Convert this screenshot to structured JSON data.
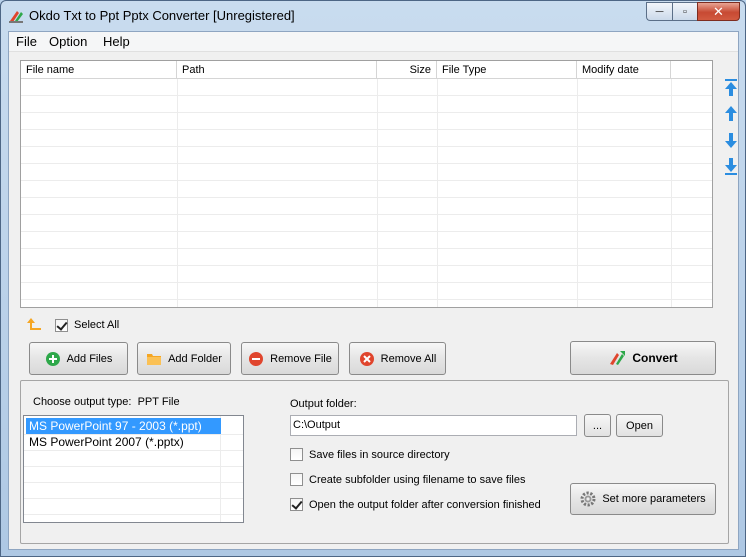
{
  "window": {
    "title": "Okdo Txt to Ppt Pptx Converter [Unregistered]",
    "minimize_glyph": "─",
    "maximize_glyph": "▫",
    "close_glyph": "✕"
  },
  "menu": {
    "items": [
      "File",
      "Option",
      "Help"
    ]
  },
  "file_list": {
    "columns": [
      "File name",
      "Path",
      "Size",
      "File Type",
      "Modify date"
    ],
    "rows": []
  },
  "side_arrows": [
    "move-top-icon",
    "move-up-icon",
    "move-down-icon",
    "move-bottom-icon"
  ],
  "select_all": {
    "label": "Select All",
    "checked": true
  },
  "buttons": {
    "add_files": "Add Files",
    "add_folder": "Add Folder",
    "remove_file": "Remove File",
    "remove_all": "Remove All",
    "convert": "Convert"
  },
  "output": {
    "type_label": "Choose output type:",
    "type_value": "PPT File",
    "types": [
      "MS PowerPoint 97 - 2003 (*.ppt)",
      "MS PowerPoint 2007 (*.pptx)"
    ],
    "selected_index": 0,
    "folder_label": "Output folder:",
    "folder_value": "C:\\Output",
    "browse_label": "...",
    "open_label": "Open",
    "options": [
      {
        "label": "Save files in source directory",
        "checked": false
      },
      {
        "label": "Create subfolder using filename to save files",
        "checked": false
      },
      {
        "label": "Open the output folder after conversion finished",
        "checked": true
      }
    ],
    "set_more_label": "Set more parameters"
  },
  "colors": {
    "selection": "#3399ff",
    "add_green": "#2ea84a",
    "folder_orange": "#f5a623",
    "remove_red": "#e0452d",
    "arrow_blue": "#2b8de0"
  }
}
